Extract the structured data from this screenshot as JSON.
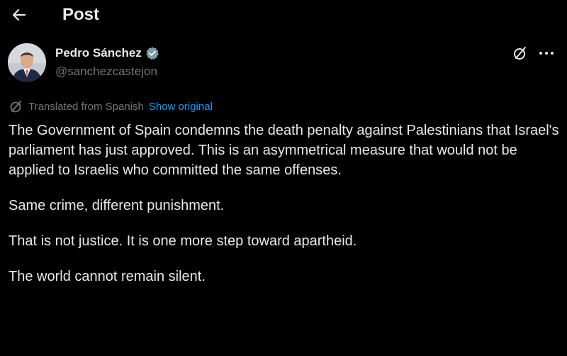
{
  "header": {
    "back_icon": "arrow-left-icon",
    "title": "Post"
  },
  "author": {
    "name": "Pedro Sánchez",
    "handle": "@sanchezcastejon",
    "verified_icon": "verified-badge-icon",
    "verified_color": "#829aab"
  },
  "actions": {
    "grok_icon": "grok-icon",
    "more_icon": "more-options-icon"
  },
  "translation": {
    "icon": "translate-icon",
    "label": "Translated from Spanish",
    "show_original": "Show original"
  },
  "tweet": {
    "paragraphs": [
      "The Government of Spain condemns the death penalty against Palestinians that Israel's parliament has just approved. This is an asymmetrical measure that would not be applied to Israelis who committed the same offenses.",
      "Same crime, different punishment.",
      "That is not justice. It is one more step toward apartheid.",
      "The world cannot remain silent."
    ]
  },
  "colors": {
    "background": "#000000",
    "text": "#e7e9ea",
    "secondary_text": "#71767b",
    "link": "#1d9bf0"
  }
}
